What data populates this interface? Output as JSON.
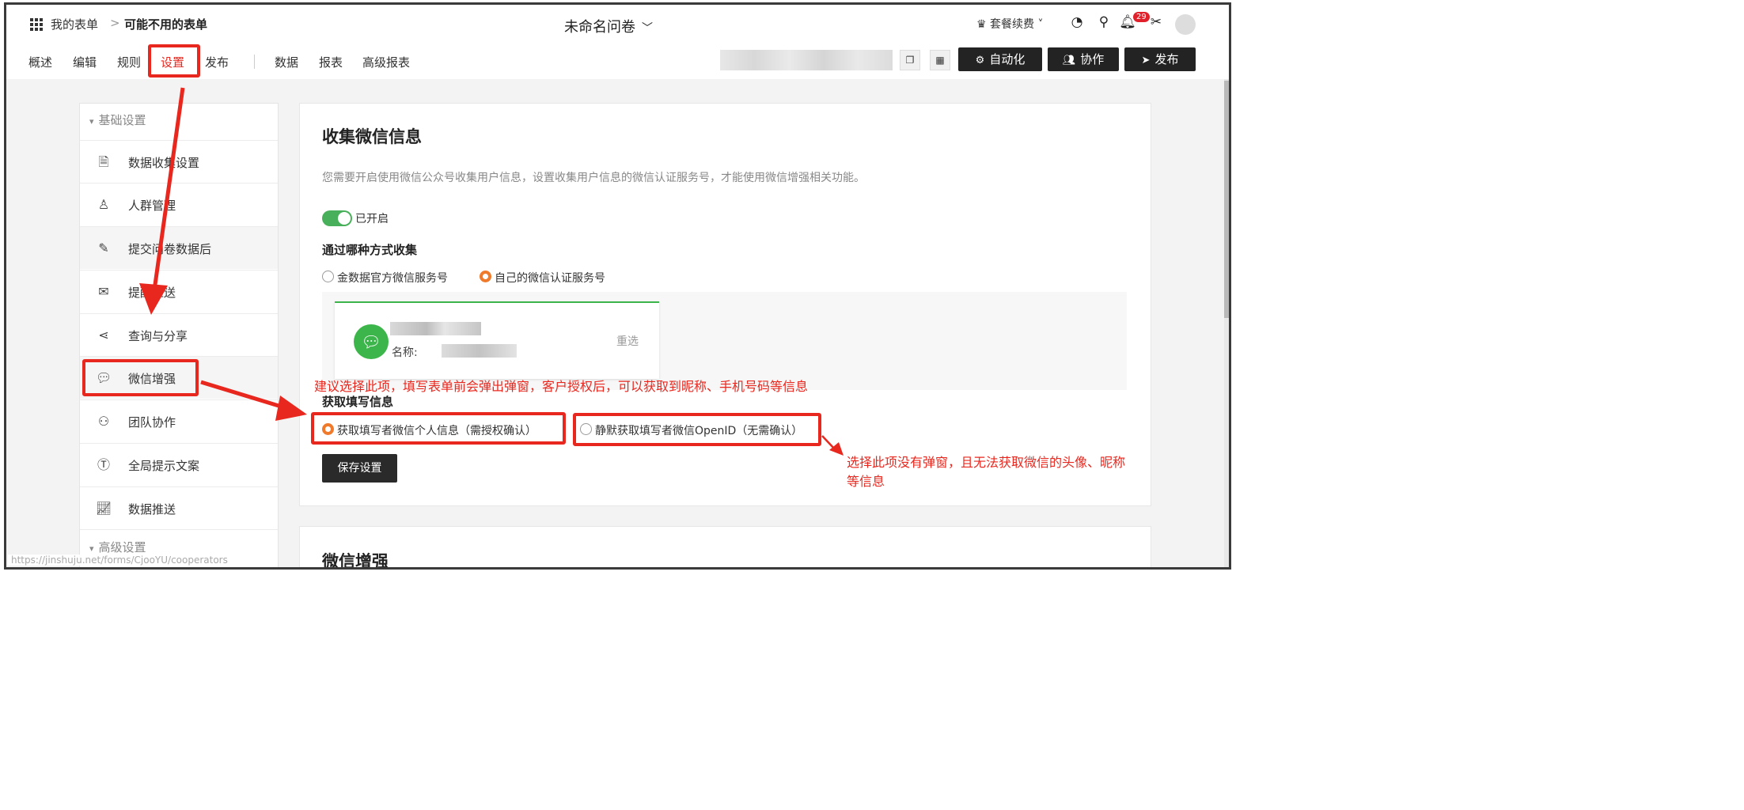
{
  "header": {
    "breadcrumb_home": "我的表单",
    "breadcrumb_sep": ">",
    "breadcrumb_current": "可能不用的表单",
    "form_title": "未命名问卷",
    "plan_label": "套餐续费",
    "notification_count": "29"
  },
  "nav": {
    "tabs": [
      "概述",
      "编辑",
      "规则",
      "设置",
      "发布",
      "数据",
      "报表",
      "高级报表"
    ]
  },
  "toolbar": {
    "automation_label": "自动化",
    "collab_label": "协作",
    "publish_label": "发布"
  },
  "sidebar": {
    "group_basic": "基础设置",
    "items": [
      {
        "label": "数据收集设置",
        "icon": "document-icon"
      },
      {
        "label": "人群管理",
        "icon": "people-icon"
      },
      {
        "label": "提交问卷数据后",
        "icon": "doc-edit-icon"
      },
      {
        "label": "提醒推送",
        "icon": "mail-icon"
      },
      {
        "label": "查询与分享",
        "icon": "share-icon"
      },
      {
        "label": "微信增强",
        "icon": "wechat-icon"
      },
      {
        "label": "团队协作",
        "icon": "team-icon"
      },
      {
        "label": "全局提示文案",
        "icon": "text-icon"
      },
      {
        "label": "数据推送",
        "icon": "chart-icon"
      }
    ],
    "group_advanced": "高级设置"
  },
  "main": {
    "title": "收集微信信息",
    "description": "您需要开启使用微信公众号收集用户信息，设置收集用户信息的微信认证服务号，才能使用微信增强相关功能。",
    "toggle_label": "已开启",
    "collect_method_title": "通过哪种方式收集",
    "method_options": [
      "金数据官方微信服务号",
      "自己的微信认证服务号"
    ],
    "wechat_name_label": "名称:",
    "reselect_label": "重选",
    "fetch_title": "获取填写信息",
    "fetch_options": [
      "获取填写者微信个人信息（需授权确认）",
      "静默获取填写者微信OpenID（无需确认）"
    ],
    "save_label": "保存设置",
    "second_title": "微信增强"
  },
  "annotations": {
    "tip_top": "建议选择此项，填写表单前会弹出弹窗，客户授权后，可以获取到昵称、手机号码等信息",
    "tip_right_line1": "选择此项没有弹窗，且无法获取微信的头像、昵称",
    "tip_right_line2": "等信息",
    "color": "#e8281f"
  },
  "status_url": "https://jinshuju.net/forms/CjooYU/cooperators",
  "colors": {
    "toggle_on": "#48b05a",
    "radio_selected": "#f07a2c",
    "wechat_green": "#3cb54a",
    "dark_button": "#232323"
  }
}
